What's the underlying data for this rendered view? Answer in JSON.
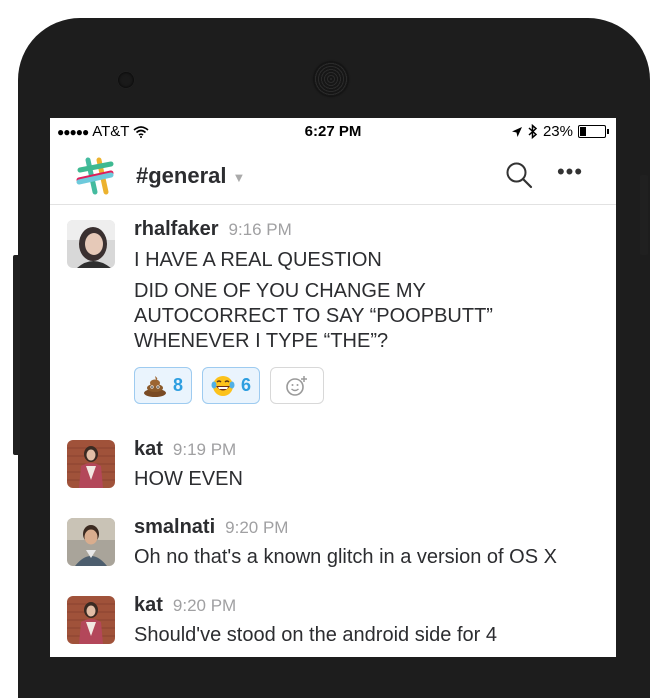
{
  "status_bar": {
    "carrier": "AT&T",
    "time": "6:27 PM",
    "battery": "23%",
    "battery_level": 0.23
  },
  "header": {
    "channel": "#general"
  },
  "messages": [
    {
      "author": "rhalfaker",
      "time": "9:16 PM",
      "lines": [
        "I HAVE A REAL QUESTION",
        "DID ONE OF YOU CHANGE MY",
        "AUTOCORRECT TO SAY “POOPBUTT”",
        "WHENEVER I TYPE “THE”?"
      ],
      "reactions": [
        {
          "emoji": "poop-emoji",
          "count": "8"
        },
        {
          "emoji": "tears-of-joy-emoji",
          "count": "6"
        }
      ]
    },
    {
      "author": "kat",
      "time": "9:19 PM",
      "lines": [
        "HOW EVEN"
      ]
    },
    {
      "author": "smalnati",
      "time": "9:20 PM",
      "lines": [
        "Oh no that's a known glitch in a version of OS X"
      ]
    },
    {
      "author": "kat",
      "time": "9:20 PM",
      "lines": [
        "Should've stood on the android side for 4"
      ]
    }
  ],
  "colors": {
    "reaction_bg": "#eaf4fd",
    "reaction_border": "#9ecbf0",
    "reaction_count": "#2d9ee0"
  }
}
